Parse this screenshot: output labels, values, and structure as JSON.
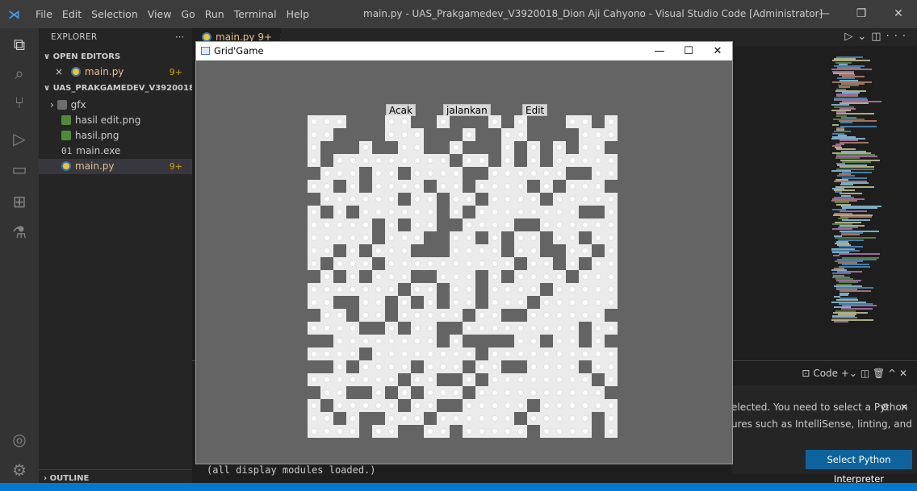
{
  "titlebar": {
    "menu": [
      "File",
      "Edit",
      "Selection",
      "View",
      "Go",
      "Run",
      "Terminal",
      "Help"
    ],
    "window_title": "main.py - UAS_Prakgamedev_V3920018_Dion Aji Cahyono - Visual Studio Code [Administrator]",
    "logo_icon": "vscode-logo-icon"
  },
  "activity_bar": {
    "icons": [
      "files-icon",
      "search-icon",
      "source-control-icon",
      "run-debug-icon",
      "remote-explorer-icon",
      "extensions-icon",
      "testing-icon",
      "account-icon",
      "settings-gear-icon"
    ]
  },
  "sidebar": {
    "header": "EXPLORER",
    "open_editors_title": "OPEN EDITORS",
    "open_editor_item": {
      "close": "×",
      "name": "main.py",
      "badge": "9+"
    },
    "project_title": "UAS_PRAKGAMEDEV_V3920018_DION ...",
    "files": [
      {
        "name": "gfx",
        "kind": "folder"
      },
      {
        "name": "hasil edit.png",
        "kind": "image"
      },
      {
        "name": "hasil.png",
        "kind": "image"
      },
      {
        "name": "main.exe",
        "kind": "binary",
        "prefix": "01"
      },
      {
        "name": "main.py",
        "kind": "python",
        "badge": "9+"
      }
    ],
    "outline_title": "OUTLINE"
  },
  "tab": {
    "label": "main.py 9+",
    "close": "×"
  },
  "panel": {
    "actions_label": "Code",
    "terminal_output": "(all display modules loaded.)"
  },
  "notification": {
    "line1": "elected. You need to select a Python",
    "line2": "ures such as IntelliSense, linting, and",
    "button": "Select Python Interpreter"
  },
  "game_window": {
    "title": "Grid'Game",
    "buttons": [
      {
        "label": "Acak"
      },
      {
        "label": "jalankan"
      },
      {
        "label": "Edit"
      }
    ],
    "grid_columns": 24,
    "grid_rows": 25,
    "grid_rows_pattern": [
      "111000110010001010001101",
      "110000111000100110000111",
      "100010011001000101010110",
      "101111111110110101011111",
      "011101101111001111110011",
      "110101111011011110101110",
      "011111101101101111011111",
      "101011111101011111111001",
      "111110101100111100111111",
      "111110111001101011011011",
      "110101110001111011001101",
      "101110111111111101101011",
      "010101110011101011110111",
      "111111101101101111011111",
      "110011010101101110111111",
      "011011011111011001111110",
      "111100101100111111111011",
      "001111111101000011011010",
      "111101111111101111111111",
      "001011110111011001111011",
      "111111101100101111111101",
      "011001010111011111111110",
      "101111101100111110111111",
      "110100111011111101111101",
      "111101100110111110111101"
    ]
  }
}
